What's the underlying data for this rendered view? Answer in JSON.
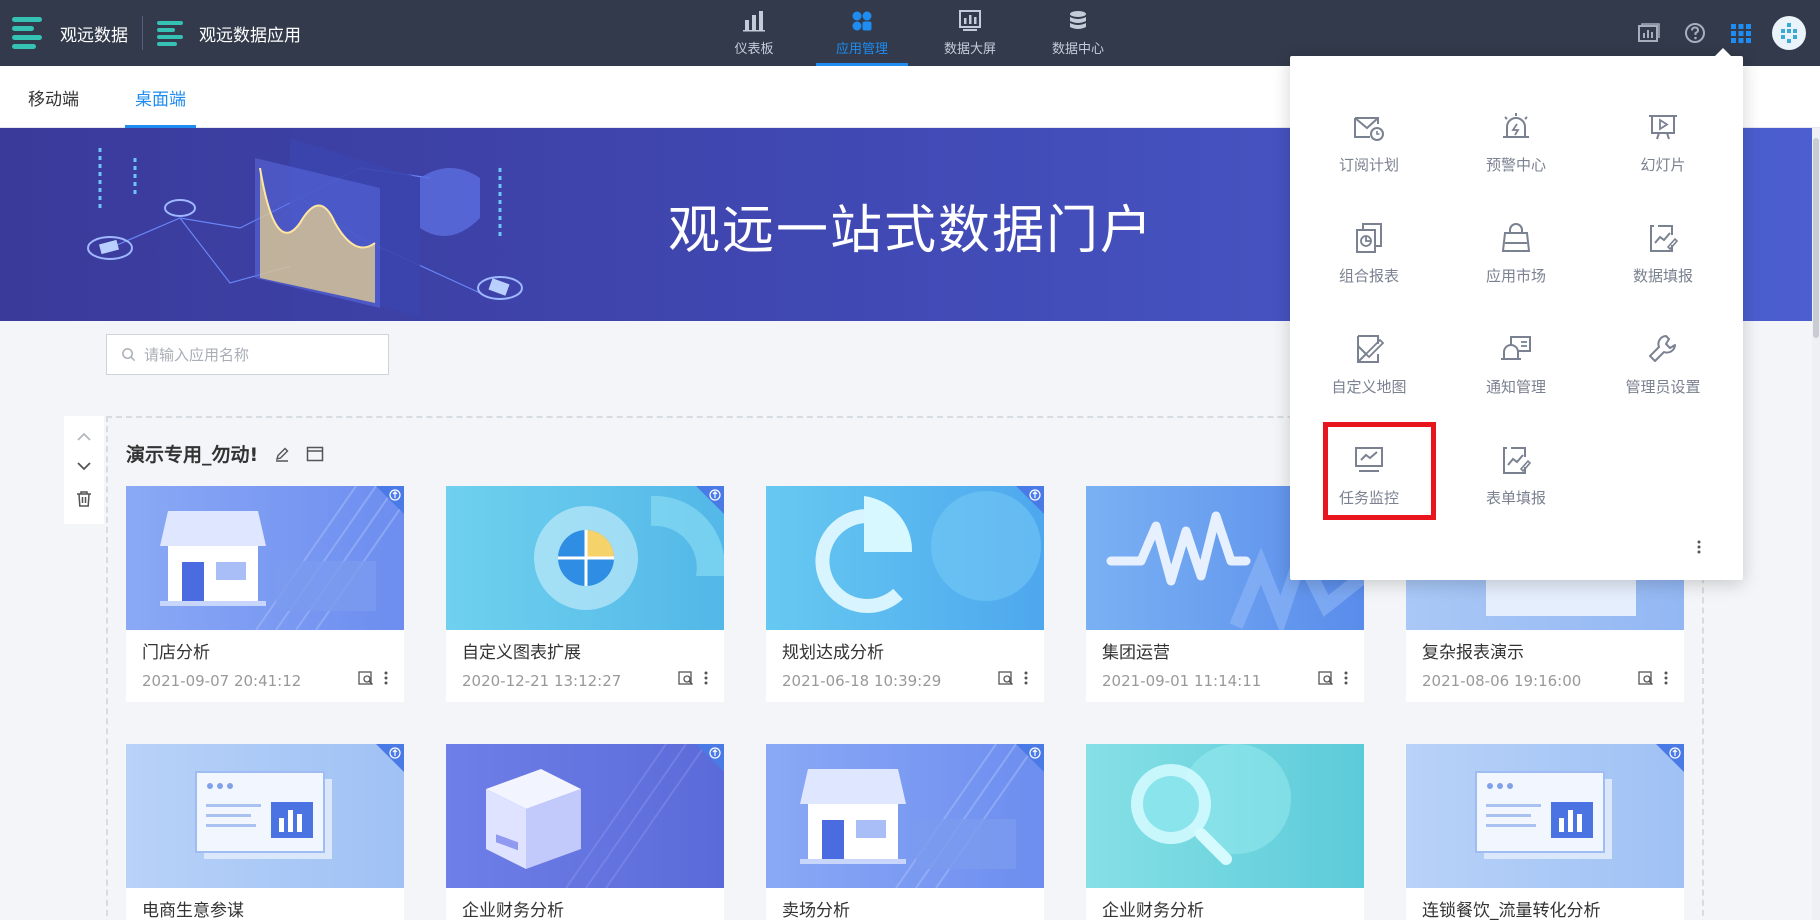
{
  "header": {
    "brand_title": "观远数据",
    "app_title": "观远数据应用",
    "nav": [
      {
        "label": "仪表板"
      },
      {
        "label": "应用管理"
      },
      {
        "label": "数据大屏"
      },
      {
        "label": "数据中心"
      }
    ]
  },
  "subtabs": [
    {
      "label": "移动端"
    },
    {
      "label": "桌面端"
    }
  ],
  "banner": {
    "title": "观远一站式数据门户"
  },
  "search": {
    "placeholder": "请输入应用名称"
  },
  "group": {
    "title": "演示专用_勿动!",
    "cards": [
      {
        "name": "门店分析",
        "date": "2021-09-07 20:41:12"
      },
      {
        "name": "自定义图表扩展",
        "date": "2020-12-21 13:12:27"
      },
      {
        "name": "规划达成分析",
        "date": "2021-06-18 10:39:29"
      },
      {
        "name": "集团运营",
        "date": "2021-09-01 11:14:11"
      },
      {
        "name": "复杂报表演示",
        "date": "2021-08-06 19:16:00"
      },
      {
        "name": "电商生意参谋",
        "date": ""
      },
      {
        "name": "企业财务分析",
        "date": ""
      },
      {
        "name": "卖场分析",
        "date": ""
      },
      {
        "name": "企业财务分析",
        "date": ""
      },
      {
        "name": "连锁餐饮_流量转化分析",
        "date": ""
      }
    ]
  },
  "dropdown": {
    "items": [
      {
        "label": "订阅计划",
        "icon": "subscription-icon"
      },
      {
        "label": "预警中心",
        "icon": "alarm-icon"
      },
      {
        "label": "幻灯片",
        "icon": "slideshow-icon"
      },
      {
        "label": "组合报表",
        "icon": "combined-report-icon"
      },
      {
        "label": "应用市场",
        "icon": "app-market-icon"
      },
      {
        "label": "数据填报",
        "icon": "data-fill-icon"
      },
      {
        "label": "自定义地图",
        "icon": "custom-map-icon"
      },
      {
        "label": "通知管理",
        "icon": "notification-icon"
      },
      {
        "label": "管理员设置",
        "icon": "admin-settings-icon"
      },
      {
        "label": "任务监控",
        "icon": "task-monitor-icon"
      },
      {
        "label": "表单填报",
        "icon": "form-fill-icon"
      }
    ]
  },
  "colors": {
    "topbar": "#323a4b",
    "accent": "#1e8cf0",
    "brand_teal": "#35c1b3",
    "highlight": "#e8141e"
  }
}
